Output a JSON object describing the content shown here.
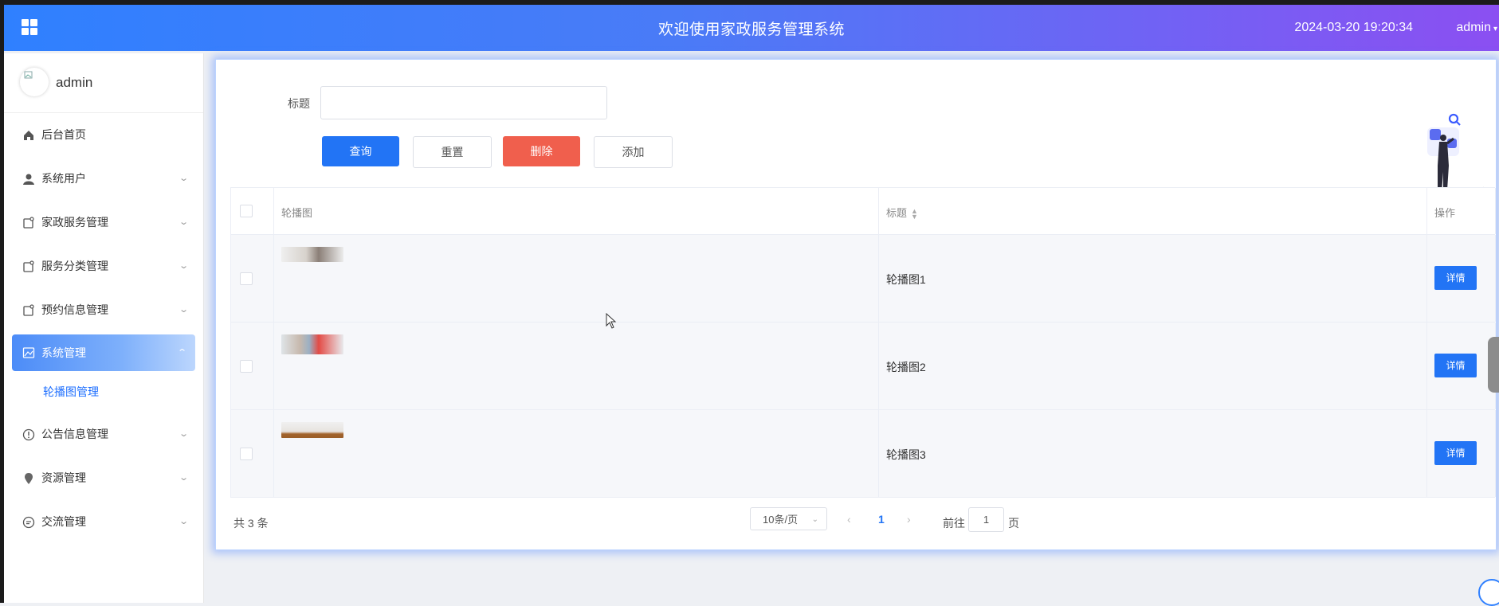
{
  "header": {
    "title": "欢迎使用家政服务管理系统",
    "datetime": "2024-03-20 19:20:34",
    "user": "admin",
    "gradient": [
      "#2f80ff",
      "#8b4ff2"
    ]
  },
  "sidebar": {
    "user_name": "admin",
    "items": [
      {
        "label": "后台首页",
        "icon": "home-icon"
      },
      {
        "label": "系统用户",
        "icon": "user-icon"
      },
      {
        "label": "家政服务管理",
        "icon": "document-icon"
      },
      {
        "label": "服务分类管理",
        "icon": "document-icon"
      },
      {
        "label": "预约信息管理",
        "icon": "document-icon"
      },
      {
        "label": "系统管理",
        "icon": "image-icon"
      },
      {
        "label": "公告信息管理",
        "icon": "info-icon"
      },
      {
        "label": "资源管理",
        "icon": "location-icon"
      },
      {
        "label": "交流管理",
        "icon": "chat-icon"
      }
    ],
    "submenu_label": "轮播图管理"
  },
  "search": {
    "label": "标题",
    "value": "",
    "buttons": {
      "query": "查询",
      "reset": "重置",
      "delete": "删除",
      "add": "添加"
    }
  },
  "table": {
    "columns": {
      "image": "轮播图",
      "title": "标题",
      "actions": "操作"
    },
    "rows": [
      {
        "title": "轮播图1",
        "action": "详情"
      },
      {
        "title": "轮播图2",
        "action": "详情"
      },
      {
        "title": "轮播图3",
        "action": "详情"
      }
    ]
  },
  "pagination": {
    "total": "共 3 条",
    "page_size": "10条/页",
    "current_page": "1",
    "goto_label": "前往",
    "goto_value": "1",
    "page_unit": "页"
  },
  "colors": {
    "primary": "#2274f5",
    "danger": "#f05f4d"
  }
}
